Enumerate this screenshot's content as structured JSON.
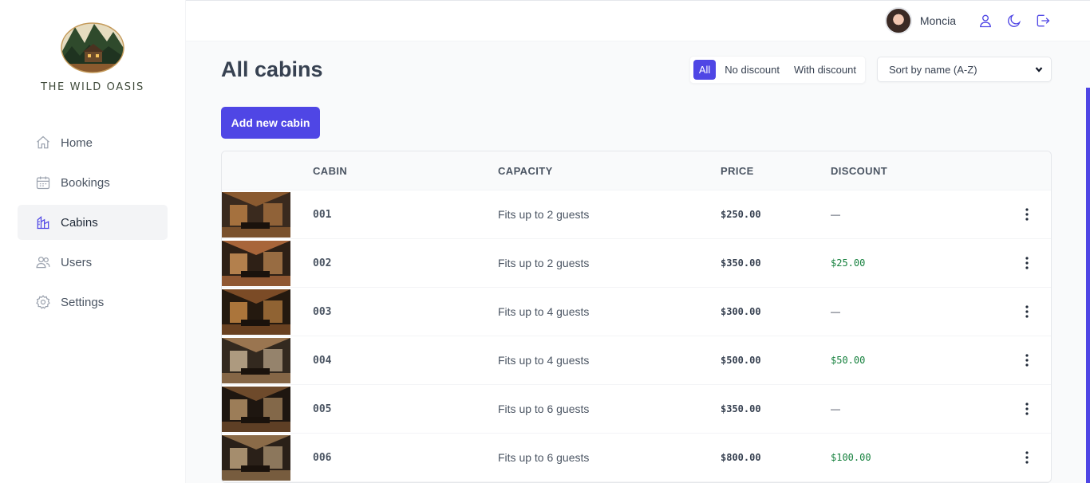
{
  "brand": {
    "name": "THE WILD OASIS"
  },
  "sidebar": {
    "items": [
      {
        "label": "Home",
        "icon": "home-icon",
        "active": false
      },
      {
        "label": "Bookings",
        "icon": "calendar-icon",
        "active": false
      },
      {
        "label": "Cabins",
        "icon": "cabins-icon",
        "active": true
      },
      {
        "label": "Users",
        "icon": "users-icon",
        "active": false
      },
      {
        "label": "Settings",
        "icon": "gear-icon",
        "active": false
      }
    ]
  },
  "header": {
    "user_name": "Moncia",
    "buttons": [
      "account-icon",
      "dark-mode-icon",
      "logout-icon"
    ]
  },
  "page": {
    "title": "All cabins",
    "filter": {
      "options": [
        "All",
        "No discount",
        "With discount"
      ],
      "active": "All"
    },
    "sort": {
      "selected": "Sort by name (A-Z)"
    },
    "add_button": "Add new cabin"
  },
  "table": {
    "headers": [
      "",
      "CABIN",
      "CAPACITY",
      "PRICE",
      "DISCOUNT"
    ],
    "rows": [
      {
        "name": "001",
        "capacity": "Fits up to 2 guests",
        "price": "$250.00",
        "discount": "—"
      },
      {
        "name": "002",
        "capacity": "Fits up to 2 guests",
        "price": "$350.00",
        "discount": "$25.00"
      },
      {
        "name": "003",
        "capacity": "Fits up to 4 guests",
        "price": "$300.00",
        "discount": "—"
      },
      {
        "name": "004",
        "capacity": "Fits up to 4 guests",
        "price": "$500.00",
        "discount": "$50.00"
      },
      {
        "name": "005",
        "capacity": "Fits up to 6 guests",
        "price": "$350.00",
        "discount": "—"
      },
      {
        "name": "006",
        "capacity": "Fits up to 6 guests",
        "price": "$800.00",
        "discount": "$100.00"
      }
    ]
  },
  "colors": {
    "accent": "#4f46e5",
    "discount": "#15803d"
  }
}
